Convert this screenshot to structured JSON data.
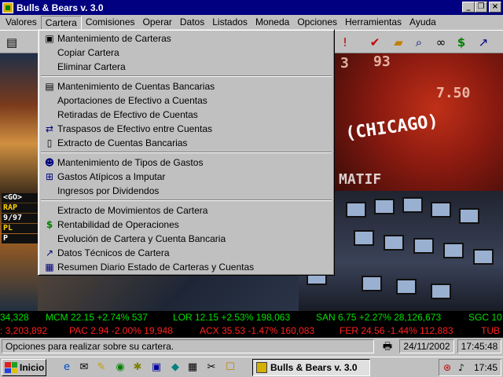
{
  "window": {
    "title": "Bulls & Bears v. 3.0",
    "buttons": {
      "minimize": "_",
      "maximize": "❐",
      "close": "×"
    }
  },
  "menubar": [
    "Valores",
    "Cartera",
    "Comisiones",
    "Operar",
    "Datos",
    "Listados",
    "Moneda",
    "Opciones",
    "Herramientas",
    "Ayuda"
  ],
  "active_menu": "Cartera",
  "toolbar": {
    "icons": [
      "document-icon",
      "alert-icon",
      "check-icon",
      "folder-icon",
      "search-icon",
      "binoculars-icon",
      "dollar-icon",
      "chart-icon"
    ]
  },
  "cartera_menu": {
    "group1": [
      "Mantenimiento de Carteras",
      "Copiar Cartera",
      "Eliminar Cartera"
    ],
    "group2": [
      "Mantenimiento de Cuentas Bancarias",
      "Aportaciones de Efectivo a Cuentas",
      "Retiradas de Efectivo de Cuentas",
      "Traspasos de Efectivo entre Cuentas",
      "Extracto de Cuentas Bancarias"
    ],
    "group3": [
      "Mantenimiento de Tipos de Gastos",
      "Gastos Atípicos a Imputar",
      "Ingresos por Dividendos"
    ],
    "group4": [
      "Extracto de Movimientos de Cartera",
      "Rentabilidad de Operaciones",
      "Evolución de Cartera y Cuenta Bancaria",
      "Datos Técnicos de Cartera",
      "Resumen Diario Estado de Carteras y Cuentas"
    ]
  },
  "background": {
    "board_numbers": [
      "3",
      "93",
      "7.50"
    ],
    "board_word": "(CHICAGO)",
    "board_word2": "MATIF",
    "left_ticker": [
      "<GO>",
      "RAP",
      "9/97",
      "PL",
      "P"
    ],
    "ticker_row1": [
      "34,328",
      "MCM 22.15 +2.74%  537",
      "LOR 12.15 +2.53%  198,063",
      "SAN 6.75 +2.27%  28,126,673",
      "SGC 10"
    ],
    "ticker_row2": [
      ": 3,203,892",
      "PAC 2.94 -2.00%  19,948",
      "ACX 35.53 -1.47%  160,083",
      "FER 24.56 -1.44%  112,883",
      "TUB"
    ]
  },
  "statusbar": {
    "message": "Opciones para realizar sobre su cartera.",
    "date": "24/11/2002",
    "time": "17:45:48"
  },
  "taskbar": {
    "start_label": "Inicio",
    "task_label": "Bulls & Bears v. 3.0",
    "clock": "17:45"
  }
}
